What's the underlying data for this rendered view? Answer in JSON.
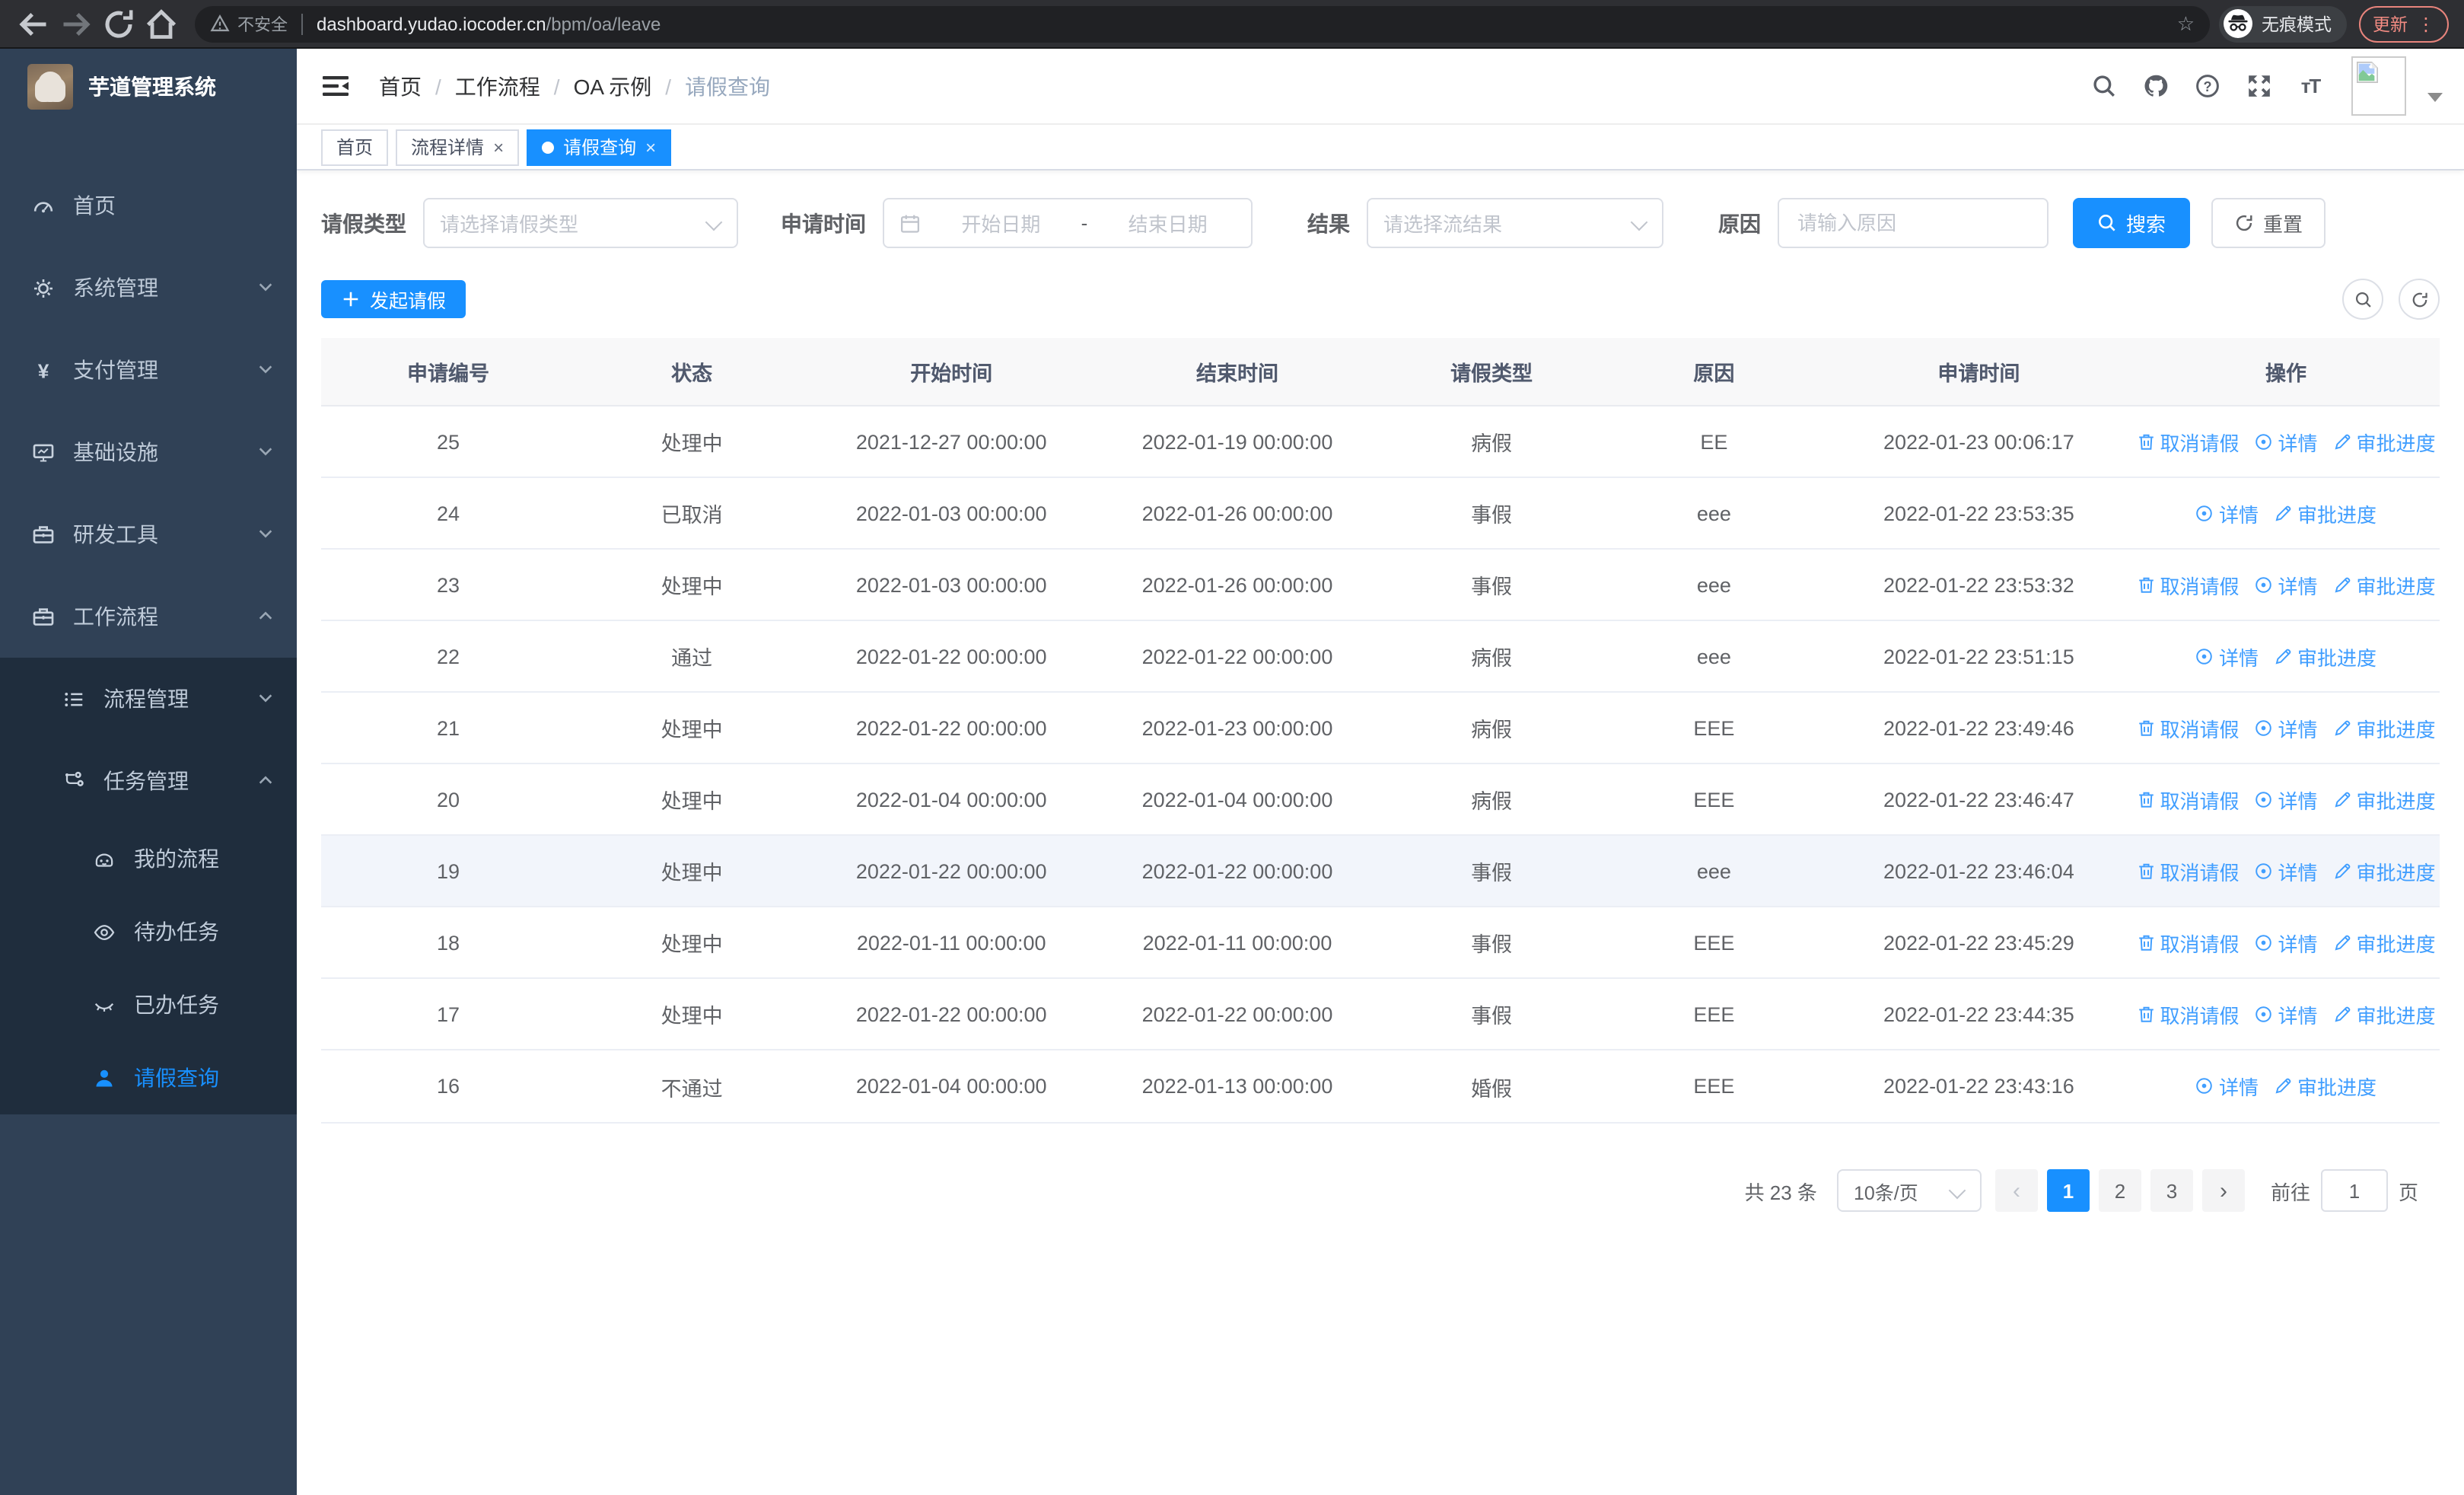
{
  "browser": {
    "security_label": "不安全",
    "url_host": "dashboard.yudao.iocoder.cn",
    "url_path": "/bpm/oa/leave",
    "incognito_label": "无痕模式",
    "update_label": "更新"
  },
  "sidebar": {
    "app_title": "芋道管理系统",
    "items": [
      {
        "key": "home",
        "label": "首页",
        "icon": "dashboard-icon",
        "level": 1,
        "arrow": null,
        "active": false
      },
      {
        "key": "system-management",
        "label": "系统管理",
        "icon": "gear-icon",
        "level": 1,
        "arrow": "down",
        "active": false
      },
      {
        "key": "payment-management",
        "label": "支付管理",
        "icon": "yen-icon",
        "level": 1,
        "arrow": "down",
        "active": false
      },
      {
        "key": "infrastructure",
        "label": "基础设施",
        "icon": "monitor-icon",
        "level": 1,
        "arrow": "down",
        "active": false
      },
      {
        "key": "dev-tools",
        "label": "研发工具",
        "icon": "toolbox-icon",
        "level": 1,
        "arrow": "down",
        "active": false
      },
      {
        "key": "workflow",
        "label": "工作流程",
        "icon": "toolbox-icon",
        "level": 1,
        "arrow": "up",
        "active": false
      },
      {
        "key": "process-management",
        "label": "流程管理",
        "icon": "list-icon",
        "level": 2,
        "arrow": "down",
        "active": false
      },
      {
        "key": "task-management",
        "label": "任务管理",
        "icon": "flow-icon",
        "level": 2,
        "arrow": "up",
        "active": false
      },
      {
        "key": "my-process",
        "label": "我的流程",
        "icon": "robot-icon",
        "level": 3,
        "arrow": null,
        "active": false
      },
      {
        "key": "todo-tasks",
        "label": "待办任务",
        "icon": "eye-icon",
        "level": 3,
        "arrow": null,
        "active": false
      },
      {
        "key": "done-tasks",
        "label": "已办任务",
        "icon": "eye-closed-icon",
        "level": 3,
        "arrow": null,
        "active": false
      },
      {
        "key": "leave-query",
        "label": "请假查询",
        "icon": "user-icon",
        "level": 3,
        "arrow": null,
        "active": true
      }
    ]
  },
  "header": {
    "breadcrumbs": [
      "首页",
      "工作流程",
      "OA 示例",
      "请假查询"
    ]
  },
  "tabs": [
    {
      "label": "首页",
      "closable": false,
      "active": false
    },
    {
      "label": "流程详情",
      "closable": true,
      "active": false
    },
    {
      "label": "请假查询",
      "closable": true,
      "active": true
    }
  ],
  "filters": {
    "leave_type_label": "请假类型",
    "leave_type_placeholder": "请选择请假类型",
    "apply_time_label": "申请时间",
    "date_start_placeholder": "开始日期",
    "date_separator": "-",
    "date_end_placeholder": "结束日期",
    "result_label": "结果",
    "result_placeholder": "请选择流结果",
    "reason_label": "原因",
    "reason_placeholder": "请输入原因",
    "search_label": "搜索",
    "reset_label": "重置"
  },
  "toolbar": {
    "create_label": "发起请假"
  },
  "table": {
    "columns": [
      "申请编号",
      "状态",
      "开始时间",
      "结束时间",
      "请假类型",
      "原因",
      "申请时间",
      "操作"
    ],
    "action_labels": {
      "cancel": "取消请假",
      "detail": "详情",
      "progress": "审批进度"
    },
    "rows": [
      {
        "id": "25",
        "status": "处理中",
        "start": "2021-12-27 00:00:00",
        "end": "2022-01-19 00:00:00",
        "type": "病假",
        "reason": "EE",
        "apply": "2022-01-23 00:06:17",
        "cancelable": true,
        "highlight": false
      },
      {
        "id": "24",
        "status": "已取消",
        "start": "2022-01-03 00:00:00",
        "end": "2022-01-26 00:00:00",
        "type": "事假",
        "reason": "eee",
        "apply": "2022-01-22 23:53:35",
        "cancelable": false,
        "highlight": false
      },
      {
        "id": "23",
        "status": "处理中",
        "start": "2022-01-03 00:00:00",
        "end": "2022-01-26 00:00:00",
        "type": "事假",
        "reason": "eee",
        "apply": "2022-01-22 23:53:32",
        "cancelable": true,
        "highlight": false
      },
      {
        "id": "22",
        "status": "通过",
        "start": "2022-01-22 00:00:00",
        "end": "2022-01-22 00:00:00",
        "type": "病假",
        "reason": "eee",
        "apply": "2022-01-22 23:51:15",
        "cancelable": false,
        "highlight": false
      },
      {
        "id": "21",
        "status": "处理中",
        "start": "2022-01-22 00:00:00",
        "end": "2022-01-23 00:00:00",
        "type": "病假",
        "reason": "EEE",
        "apply": "2022-01-22 23:49:46",
        "cancelable": true,
        "highlight": false
      },
      {
        "id": "20",
        "status": "处理中",
        "start": "2022-01-04 00:00:00",
        "end": "2022-01-04 00:00:00",
        "type": "病假",
        "reason": "EEE",
        "apply": "2022-01-22 23:46:47",
        "cancelable": true,
        "highlight": false
      },
      {
        "id": "19",
        "status": "处理中",
        "start": "2022-01-22 00:00:00",
        "end": "2022-01-22 00:00:00",
        "type": "事假",
        "reason": "eee",
        "apply": "2022-01-22 23:46:04",
        "cancelable": true,
        "highlight": true
      },
      {
        "id": "18",
        "status": "处理中",
        "start": "2022-01-11 00:00:00",
        "end": "2022-01-11 00:00:00",
        "type": "事假",
        "reason": "EEE",
        "apply": "2022-01-22 23:45:29",
        "cancelable": true,
        "highlight": false
      },
      {
        "id": "17",
        "status": "处理中",
        "start": "2022-01-22 00:00:00",
        "end": "2022-01-22 00:00:00",
        "type": "事假",
        "reason": "EEE",
        "apply": "2022-01-22 23:44:35",
        "cancelable": true,
        "highlight": false
      },
      {
        "id": "16",
        "status": "不通过",
        "start": "2022-01-04 00:00:00",
        "end": "2022-01-13 00:00:00",
        "type": "婚假",
        "reason": "EEE",
        "apply": "2022-01-22 23:43:16",
        "cancelable": false,
        "highlight": false
      }
    ]
  },
  "pagination": {
    "total_label": "共 23 条",
    "page_size": "10条/页",
    "pages": [
      "1",
      "2",
      "3"
    ],
    "active_page": "1",
    "goto_label": "前往",
    "goto_value": "1",
    "goto_suffix": "页"
  }
}
